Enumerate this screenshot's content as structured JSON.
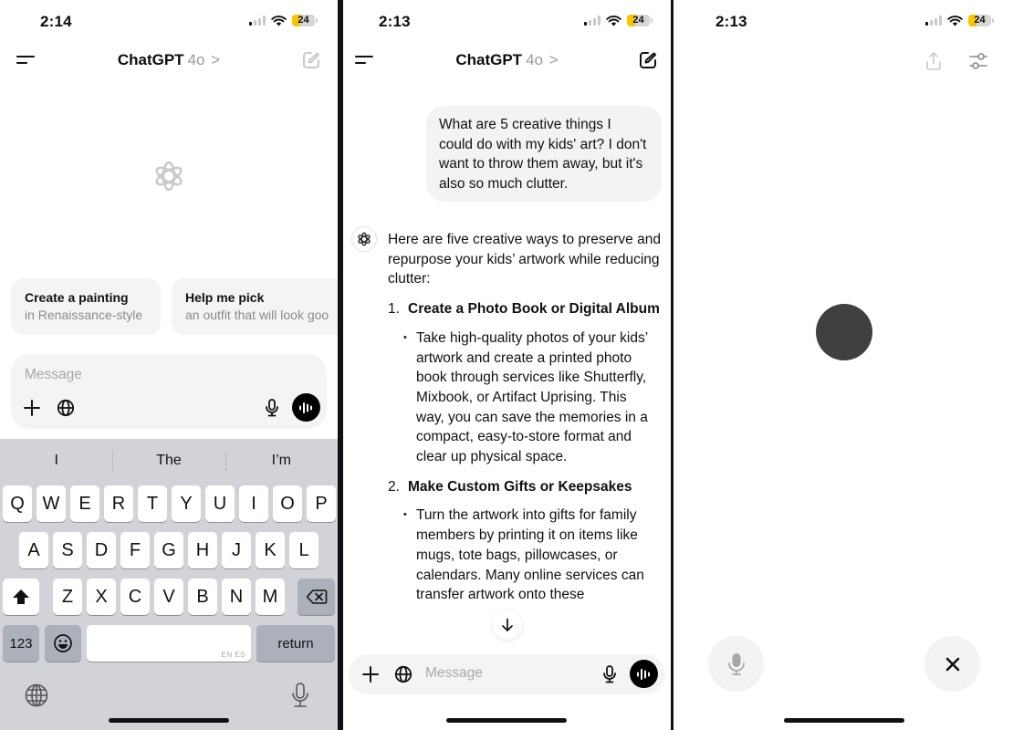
{
  "screens": [
    {
      "status": {
        "time": "2:14",
        "battery": "24",
        "battery_level": 0.24
      },
      "header": {
        "app": "ChatGPT",
        "model": "4o",
        "chevron": ">"
      },
      "suggestions": [
        {
          "title": "Create a painting",
          "subtitle": "in Renaissance-style"
        },
        {
          "title": "Help me pick",
          "subtitle": "an outfit that will look goo"
        }
      ],
      "composer": {
        "placeholder": "Message"
      },
      "keyboard": {
        "predictions": [
          "I",
          "The",
          "I’m"
        ],
        "row1": [
          "Q",
          "W",
          "E",
          "R",
          "T",
          "Y",
          "U",
          "I",
          "O",
          "P"
        ],
        "row2": [
          "A",
          "S",
          "D",
          "F",
          "G",
          "H",
          "J",
          "K",
          "L"
        ],
        "row3": [
          "Z",
          "X",
          "C",
          "V",
          "B",
          "N",
          "M"
        ],
        "numbers_label": "123",
        "return_label": "return",
        "space_langs": "EN ES"
      }
    },
    {
      "status": {
        "time": "2:13",
        "battery": "24",
        "battery_level": 0.24
      },
      "header": {
        "app": "ChatGPT",
        "model": "4o",
        "chevron": ">"
      },
      "user_message": "What are 5 creative things I could do with my kids' art? I don't want to throw them away, but it's also so much clutter.",
      "assistant": {
        "intro": "Here are five creative ways to preserve and repurpose your kids’ artwork while reducing clutter:",
        "items": [
          {
            "num": "1.",
            "title": "Create a Photo Book or Digital Album",
            "bullet": "Take high-quality photos of your kids’ artwork and create a printed photo book through services like Shutterfly, Mixbook, or Artifact Uprising. This way, you can save the memories in a compact, easy-to-store format and clear up physical space."
          },
          {
            "num": "2.",
            "title": "Make Custom Gifts or Keepsakes",
            "bullet": "Turn the artwork into gifts for family members by printing it on items like mugs, tote bags, pillowcases, or calendars. Many online services can transfer artwork onto these"
          }
        ]
      },
      "composer": {
        "placeholder": "Message"
      }
    },
    {
      "status": {
        "time": "2:13",
        "battery": "24",
        "battery_level": 0.24
      }
    }
  ],
  "colors": {
    "battery": "#f7c600",
    "orb": "#404040",
    "keyboard_bg": "#d1d3d9"
  }
}
